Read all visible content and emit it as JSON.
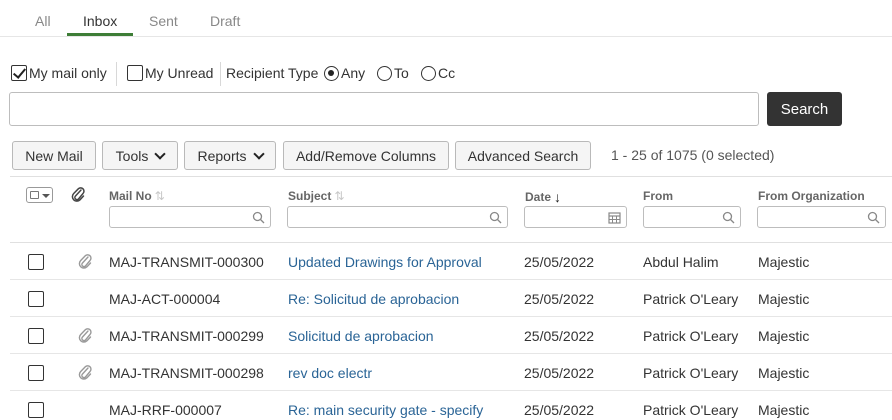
{
  "tabs": [
    {
      "label": "All"
    },
    {
      "label": "Inbox",
      "active": true
    },
    {
      "label": "Sent"
    },
    {
      "label": "Draft"
    }
  ],
  "filters": {
    "my_mail_only": {
      "label": "My mail only",
      "checked": true
    },
    "my_unread": {
      "label": "My Unread",
      "checked": false
    },
    "recipient_type_label": "Recipient Type",
    "recipient_options": [
      {
        "label": "Any",
        "selected": true
      },
      {
        "label": "To",
        "selected": false
      },
      {
        "label": "Cc",
        "selected": false
      }
    ]
  },
  "search": {
    "value": "",
    "button_label": "Search"
  },
  "toolbar": {
    "new_mail": "New Mail",
    "tools": "Tools",
    "reports": "Reports",
    "add_remove_columns": "Add/Remove Columns",
    "advanced_search": "Advanced Search",
    "pager_text": "1 - 25 of 1075 (0 selected)"
  },
  "columns": {
    "mail_no": "Mail No",
    "subject": "Subject",
    "date": "Date",
    "from": "From",
    "from_org": "From Organization"
  },
  "rows": [
    {
      "has_attachment": true,
      "mail_no": "MAJ-TRANSMIT-000300",
      "subject": "Updated Drawings for Approval",
      "date": "25/05/2022",
      "from": "Abdul Halim",
      "org": "Majestic"
    },
    {
      "has_attachment": false,
      "mail_no": "MAJ-ACT-000004",
      "subject": "Re: Solicitud de aprobacion",
      "date": "25/05/2022",
      "from": "Patrick O'Leary",
      "org": "Majestic"
    },
    {
      "has_attachment": true,
      "mail_no": "MAJ-TRANSMIT-000299",
      "subject": "Solicitud de aprobacion",
      "date": "25/05/2022",
      "from": "Patrick O'Leary",
      "org": "Majestic"
    },
    {
      "has_attachment": true,
      "mail_no": "MAJ-TRANSMIT-000298",
      "subject": "rev doc electr",
      "date": "25/05/2022",
      "from": "Patrick O'Leary",
      "org": "Majestic"
    },
    {
      "has_attachment": false,
      "mail_no": "MAJ-RRF-000007",
      "subject": "Re: main security gate - specify",
      "date": "25/05/2022",
      "from": "Patrick O'Leary",
      "org": "Majestic"
    }
  ],
  "colors": {
    "accent_underline": "#3d7d36",
    "link": "#2a6496",
    "search_button": "#333333"
  }
}
